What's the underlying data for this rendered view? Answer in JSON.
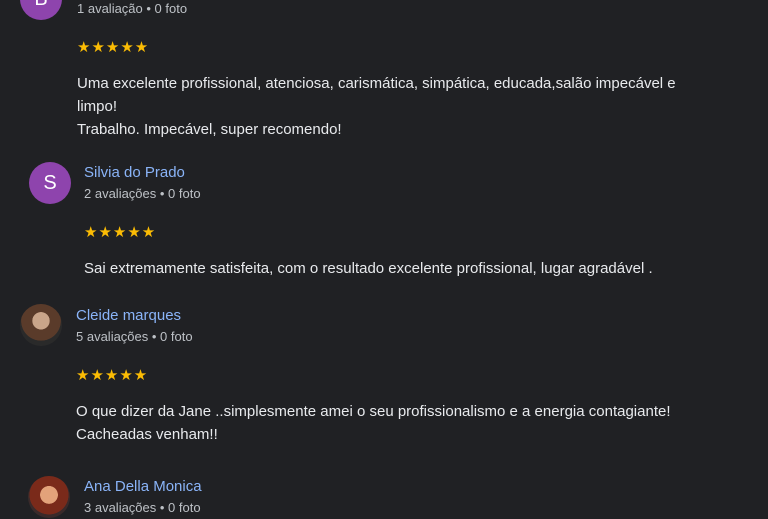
{
  "reviews": [
    {
      "avatar_letter": "B",
      "name": "",
      "meta": "1 avaliação • 0 foto",
      "stars": "★★★★★",
      "lines": [
        "Uma excelente profissional, atenciosa, carismática, simpática, educada,salão impecável e",
        "limpo!",
        "Trabalho. Impecável, super recomendo!"
      ]
    },
    {
      "avatar_letter": "S",
      "name": "Silvia do Prado",
      "meta": "2 avaliações • 0 foto",
      "stars": "★★★★★",
      "lines": [
        "Sai extremamente satisfeita, com o resultado excelente profissional, lugar agradável ."
      ]
    },
    {
      "avatar_letter": "",
      "name": "Cleide marques",
      "meta": "5 avaliações • 0 foto",
      "stars": "★★★★★",
      "lines": [
        "O que dizer da Jane ..simplesmente amei o seu profissionalismo e a energia contagiante!",
        "Cacheadas venham!!"
      ]
    },
    {
      "avatar_letter": "",
      "name": "Ana Della Monica",
      "meta": "3 avaliações • 0 foto",
      "stars": "",
      "lines": []
    }
  ]
}
